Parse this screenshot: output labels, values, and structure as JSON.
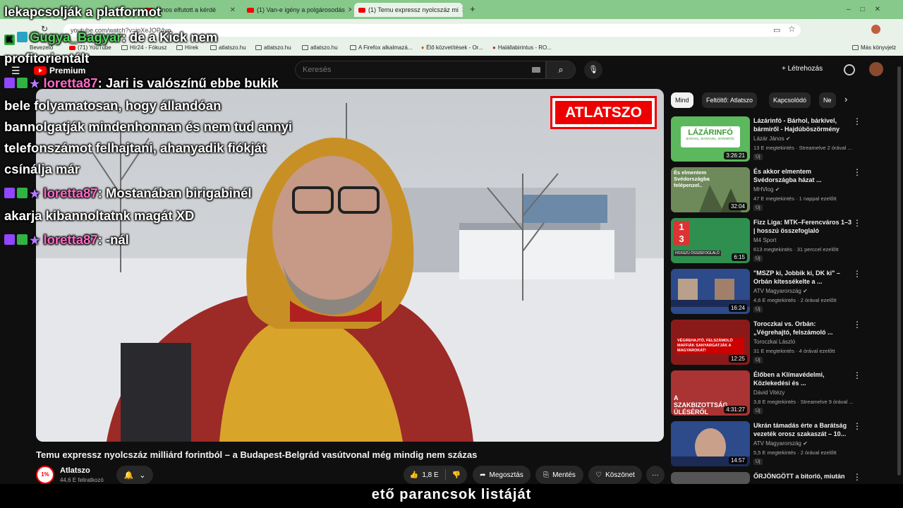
{
  "browser": {
    "tabs": [
      {
        "label": "János elfutott a kérdé"
      },
      {
        "label": "(1) Van-e igény a polgárosodás"
      },
      {
        "label": "(1) Temu expressz nyolcszáz mi"
      }
    ],
    "new_tab": "+",
    "url": "youtube.com/watch?v=jpXeJOP4yo",
    "bookmarks": [
      "Bevezető",
      "(71) YouTube",
      "Hír24 - Fókusz",
      "Hírek",
      "atlatszo.hu",
      "atlatszo.hu",
      "atlatszo.hu",
      "A Firefox alkalmazá...",
      "Élő közvetítések - Or...",
      "Halállabirintus - RO..."
    ],
    "other_bookmarks": "Más könyvjelz"
  },
  "youtube": {
    "logo": "Premium",
    "search_placeholder": "Keresés",
    "create": "Létrehozás"
  },
  "video": {
    "title": "Temu expressz nyolcszáz milliárd forintból – a Budapest-Belgrád vasútvonal még mindig nem százas",
    "logo_text": "ATLATSZO",
    "channel": "Atlatszo",
    "channel_avatar": "1%",
    "subscribers": "44,6 E feliratkozó",
    "likes": "1,8 E",
    "share": "Megosztás",
    "save": "Mentés",
    "thanks": "Köszönet",
    "more": "···"
  },
  "chips": [
    "Mind",
    "Feltöltő: Atlatszo",
    "Kapcsolódó",
    "Ne"
  ],
  "recommendations": [
    {
      "title": "Lázárinfó - Bárhol, bárkivel, bármiről - Hajdúböszörmény",
      "channel": "Lázár János",
      "meta": "13 E megtekintés · Streamelve 2 órával ...",
      "duration": "3:26:21",
      "badge": "Új",
      "thumb_text": "LÁZÁRINFÓ",
      "thumb_sub": "BÁRHOL, BÁRKIVEL, BÁRMIRŐL",
      "color": "#5cb85c"
    },
    {
      "title": "És akkor elmentem Svédországba házat ...",
      "channel": "MHVlog",
      "meta": "47 E megtekintés · 1 nappal ezelőtt",
      "duration": "32:04",
      "badge": "Új",
      "thumb_text": "És elmentem Svédországba felépenzel..",
      "color": "#6f8a5a"
    },
    {
      "title": "Fizz Liga: MTK–Ferencváros 1–3 | hosszú összefoglaló",
      "channel": "M4 Sport",
      "meta": "613 megtekintés · 31 perccel ezelőtt",
      "duration": "6:15",
      "badge": "Új",
      "thumb_text": "HOSSZÚ ÖSSZEFOGLALÓ",
      "score_a": "1",
      "score_b": "3",
      "color": "#2f8f4f"
    },
    {
      "title": "\"MSZP ki, Jobbik ki, DK ki\" – Orbán kitessékelte a ...",
      "channel": "ATV Magyarország",
      "meta": "4,6 E megtekintés · 2 órával ezelőtt",
      "duration": "16:24",
      "badge": "Új",
      "color": "#2d4a8a"
    },
    {
      "title": "Toroczkai vs. Orbán: „Végrehajtó, felszámoló ...",
      "channel": "Toroczkai László",
      "meta": "31 E megtekintés · 4 órával ezelőtt",
      "duration": "12:25",
      "badge": "Új",
      "thumb_text": "VÉGREHAJTÓ, FELSZÁMOLÓ MAFFIÁK SANYARGATJÁK A MAGYAROKAT!",
      "color": "#8a1a1a"
    },
    {
      "title": "Élőben a Klímavédelmi, Közlekedési és ...",
      "channel": "Dávid Vitézy",
      "meta": "3,8 E megtekintés · Streamelve 9 órával ...",
      "duration": "4:31:27",
      "badge": "Új",
      "thumb_text": "A SZAKBIZOTTSÁG ÜLÉSÉRŐL",
      "color": "#a33"
    },
    {
      "title": "Ukrán támadás érte a Barátság vezeték orosz szakaszát – 10...",
      "channel": "ATV Magyarország",
      "meta": "5,5 E megtekintés · 2 órával ezelőtt",
      "duration": "14:57",
      "badge": "Új",
      "color": "#2d4a8a"
    },
    {
      "title": "ŐRJÖNGÖTT a bitorló, miután",
      "channel": "",
      "meta": "",
      "duration": "",
      "badge": "",
      "color": "#555"
    }
  ],
  "chat": [
    {
      "user": "",
      "text": "lekapcsolják a platformot"
    },
    {
      "user": "Gugya_Bagyar",
      "text": ": de a Kick nem profitorientált"
    },
    {
      "user": "loretta87",
      "text": ": Jari is valószínű ebbe bukik bele folyamatosan, hogy állandóan bannolgatják mindenhonnan és nem tud annyi telefonszámot felhajtani, ahanyadik fiókját csínálja már"
    },
    {
      "user": "loretta87",
      "text": ": Mostanában birigabinél akarja kibannoltatnk magát XD"
    },
    {
      "user": "loretta87",
      "text": ": -nál"
    }
  ],
  "subtitle": "ető parancsok listáját"
}
